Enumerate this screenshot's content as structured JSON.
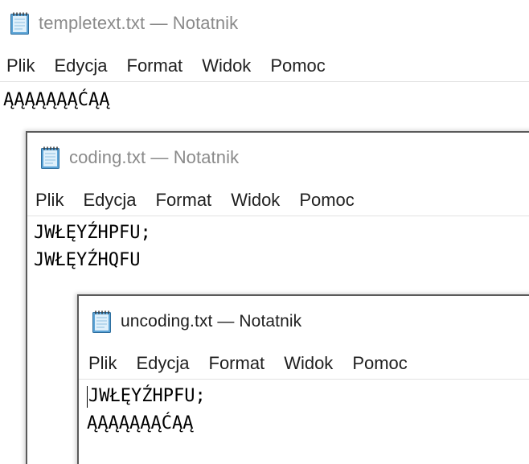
{
  "windows": [
    {
      "title": "templetext.txt — Notatnik",
      "state": "inactive",
      "icon": "notepad-icon",
      "menu": [
        "Plik",
        "Edycja",
        "Format",
        "Widok",
        "Pomoc"
      ],
      "lines": [
        "ĄĄĄĄĄĄĄĆĄĄ"
      ]
    },
    {
      "title": "coding.txt — Notatnik",
      "state": "inactive",
      "icon": "notepad-icon",
      "menu": [
        "Plik",
        "Edycja",
        "Format",
        "Widok",
        "Pomoc"
      ],
      "lines": [
        "JWŁĘYŹHPFU;",
        "JWŁĘYŹHQFU"
      ]
    },
    {
      "title": "uncoding.txt — Notatnik",
      "state": "active",
      "icon": "notepad-icon",
      "menu": [
        "Plik",
        "Edycja",
        "Format",
        "Widok",
        "Pomoc"
      ],
      "lines": [
        "JWŁĘYŹHPFU;",
        "ĄĄĄĄĄĄĄĆĄĄ"
      ]
    }
  ],
  "colors": {
    "inactive_title": "#8a8a8a",
    "active_title": "#1f1f1f",
    "notepad_icon_blue": "#5ba3d6"
  }
}
